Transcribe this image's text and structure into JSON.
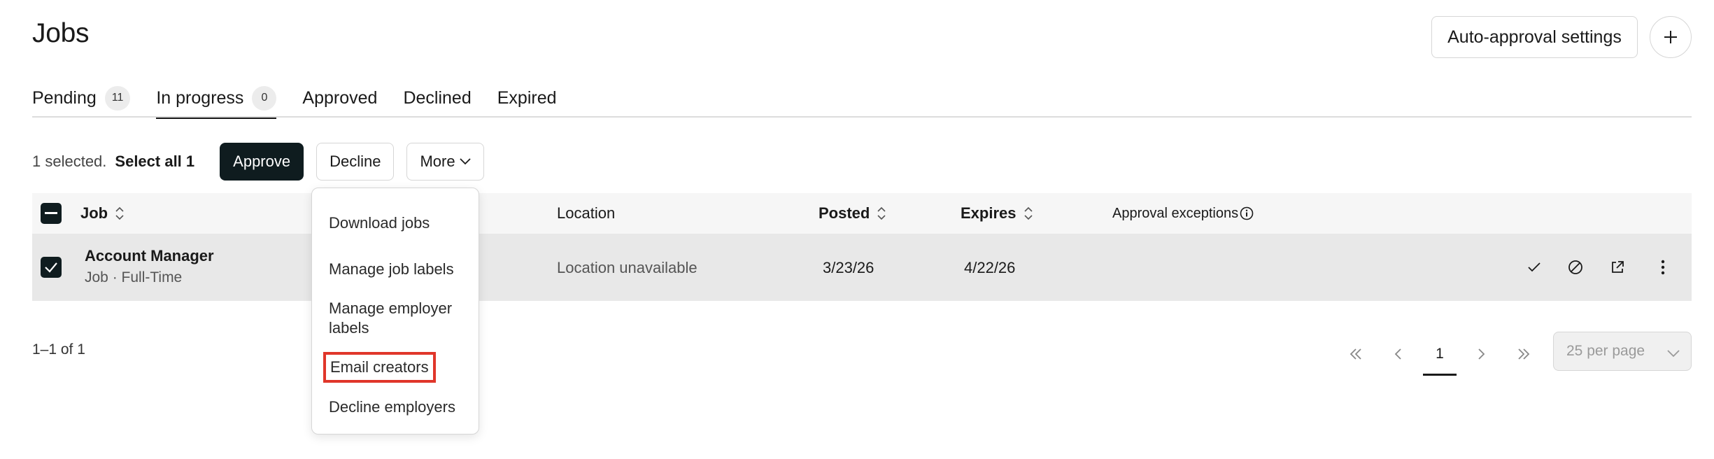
{
  "page": {
    "title": "Jobs"
  },
  "header": {
    "auto_approval_label": "Auto-approval settings"
  },
  "tabs": [
    {
      "label": "Pending",
      "count": "11"
    },
    {
      "label": "In progress",
      "count": "0"
    },
    {
      "label": "Approved"
    },
    {
      "label": "Declined"
    },
    {
      "label": "Expired"
    }
  ],
  "bulk": {
    "selected_text": "1 selected.",
    "select_all_text": "Select all 1",
    "approve_label": "Approve",
    "decline_label": "Decline",
    "more_label": "More"
  },
  "table": {
    "columns": {
      "job": "Job",
      "location": "Location",
      "posted": "Posted",
      "expires": "Expires",
      "approval_exceptions": "Approval exceptions"
    },
    "rows": [
      {
        "title": "Account Manager",
        "subtitle": "Job · Full-Time",
        "location": "Location unavailable",
        "posted": "3/23/26",
        "expires": "4/22/26"
      }
    ]
  },
  "more_menu": {
    "items": [
      "Download jobs",
      "Manage job labels",
      "Manage employer labels",
      "Email creators",
      "Decline employers"
    ]
  },
  "footer": {
    "range_text": "1–1 of 1",
    "current_page": "1",
    "per_page": "25 per page"
  },
  "colors": {
    "primary_dark": "#0f1c1f",
    "row_selected": "#e8e8e8",
    "highlight": "#e0362a"
  }
}
